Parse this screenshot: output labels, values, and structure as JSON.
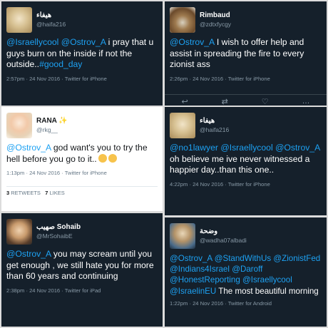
{
  "tweets": [
    {
      "name": "هيفاء",
      "handle": "@haifa216",
      "text_parts": [
        {
          "t": "@Israellycool",
          "m": true
        },
        {
          "t": " ",
          "m": false
        },
        {
          "t": "@Ostrov_A",
          "m": true
        },
        {
          "t": " i pray that u guys burn on the inside if not the outside..",
          "m": false
        },
        {
          "t": "#good_day",
          "m": true
        }
      ],
      "meta": "2:57pm · 24 Nov 2016 · Twitter for iPhone"
    },
    {
      "name": "Rimbaud",
      "handle": "@zdtxfycgy",
      "text_parts": [
        {
          "t": "@Ostrov_A",
          "m": true
        },
        {
          "t": " I wish to offer help and assist in spreading the fire to every zionist ass",
          "m": false
        }
      ],
      "meta": "2:26pm · 24 Nov 2016 · Twitter for iPhone"
    },
    {
      "name": "RANA",
      "handle": "@rkg__",
      "text_parts": [
        {
          "t": "@Ostrov_A",
          "m": true
        },
        {
          "t": " god want's you to try the hell before you go to it..",
          "m": false
        }
      ],
      "meta": "1:13pm · 24 Nov 2016 · Twitter for iPhone",
      "retweets": "3",
      "retweets_label": "RETWEETS",
      "likes": "7",
      "likes_label": "LIKES"
    },
    {
      "name": "هيفاء",
      "handle": "@haifa216",
      "text_parts": [
        {
          "t": "@no1lawyer",
          "m": true
        },
        {
          "t": " ",
          "m": false
        },
        {
          "t": "@Israellycool",
          "m": true
        },
        {
          "t": " ",
          "m": false
        },
        {
          "t": "@Ostrov_A",
          "m": true
        },
        {
          "t": " oh believe me ive never witnessed a happier day..than this one..",
          "m": false
        }
      ],
      "meta": "4:22pm · 24 Nov 2016 · Twitter for iPhone"
    },
    {
      "name": "صهيب Sohaib",
      "handle": "@MrSohaibE",
      "text_parts": [
        {
          "t": "@Ostrov_A",
          "m": true
        },
        {
          "t": " you may scream until you get enough , we still hate you for more than 60 years and continuing",
          "m": false
        }
      ],
      "meta": "2:38pm · 24 Nov 2016 · Twitter for iPad"
    },
    {
      "name": "وضحة",
      "handle": "@wadha07albadi",
      "text_parts": [
        {
          "t": "@Ostrov_A",
          "m": true
        },
        {
          "t": " ",
          "m": false
        },
        {
          "t": "@StandWithUs",
          "m": true
        },
        {
          "t": " ",
          "m": false
        },
        {
          "t": "@ZionistFed",
          "m": true
        },
        {
          "t": " ",
          "m": false
        },
        {
          "t": "@Indians4Israel",
          "m": true
        },
        {
          "t": " ",
          "m": false
        },
        {
          "t": "@Daroff",
          "m": true
        },
        {
          "t": " ",
          "m": false
        },
        {
          "t": "@HonestReporting",
          "m": true
        },
        {
          "t": " ",
          "m": false
        },
        {
          "t": "@Israellycool",
          "m": true
        },
        {
          "t": " ",
          "m": false
        },
        {
          "t": "@IsraelinEU",
          "m": true
        },
        {
          "t": " The most beautiful morning",
          "m": false
        }
      ],
      "meta": "1:22pm · 24 Nov 2016 · Twitter for Android"
    }
  ],
  "icons": [
    "reply-icon",
    "retweet-icon",
    "like-icon",
    "more-icon"
  ],
  "colors": {
    "dark_bg": "#15202b",
    "mention": "#1da1f2",
    "meta": "#8899a6"
  }
}
